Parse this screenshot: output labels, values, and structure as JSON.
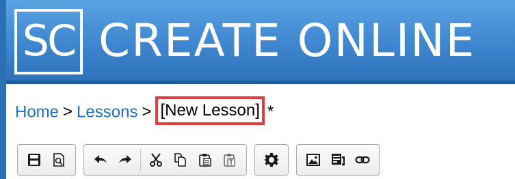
{
  "header": {
    "logo_text": "SC",
    "title": "CREATE ONLINE"
  },
  "breadcrumb": {
    "items": [
      "Home",
      "Lessons"
    ],
    "separator": ">",
    "current": "[New Lesson]",
    "dirty_marker": "*"
  },
  "toolbar": {
    "groups": [
      [
        "save-icon",
        "preview-icon"
      ],
      [
        "undo-icon",
        "redo-icon",
        "cut-icon",
        "copy-icon",
        "paste-icon",
        "paste-as-text-icon"
      ],
      [
        "settings-icon"
      ],
      [
        "image-icon",
        "video-icon",
        "link-icon"
      ]
    ]
  },
  "colors": {
    "banner": "#3e86cf",
    "link": "#1f6fc4",
    "highlight": "#e53d3d"
  }
}
